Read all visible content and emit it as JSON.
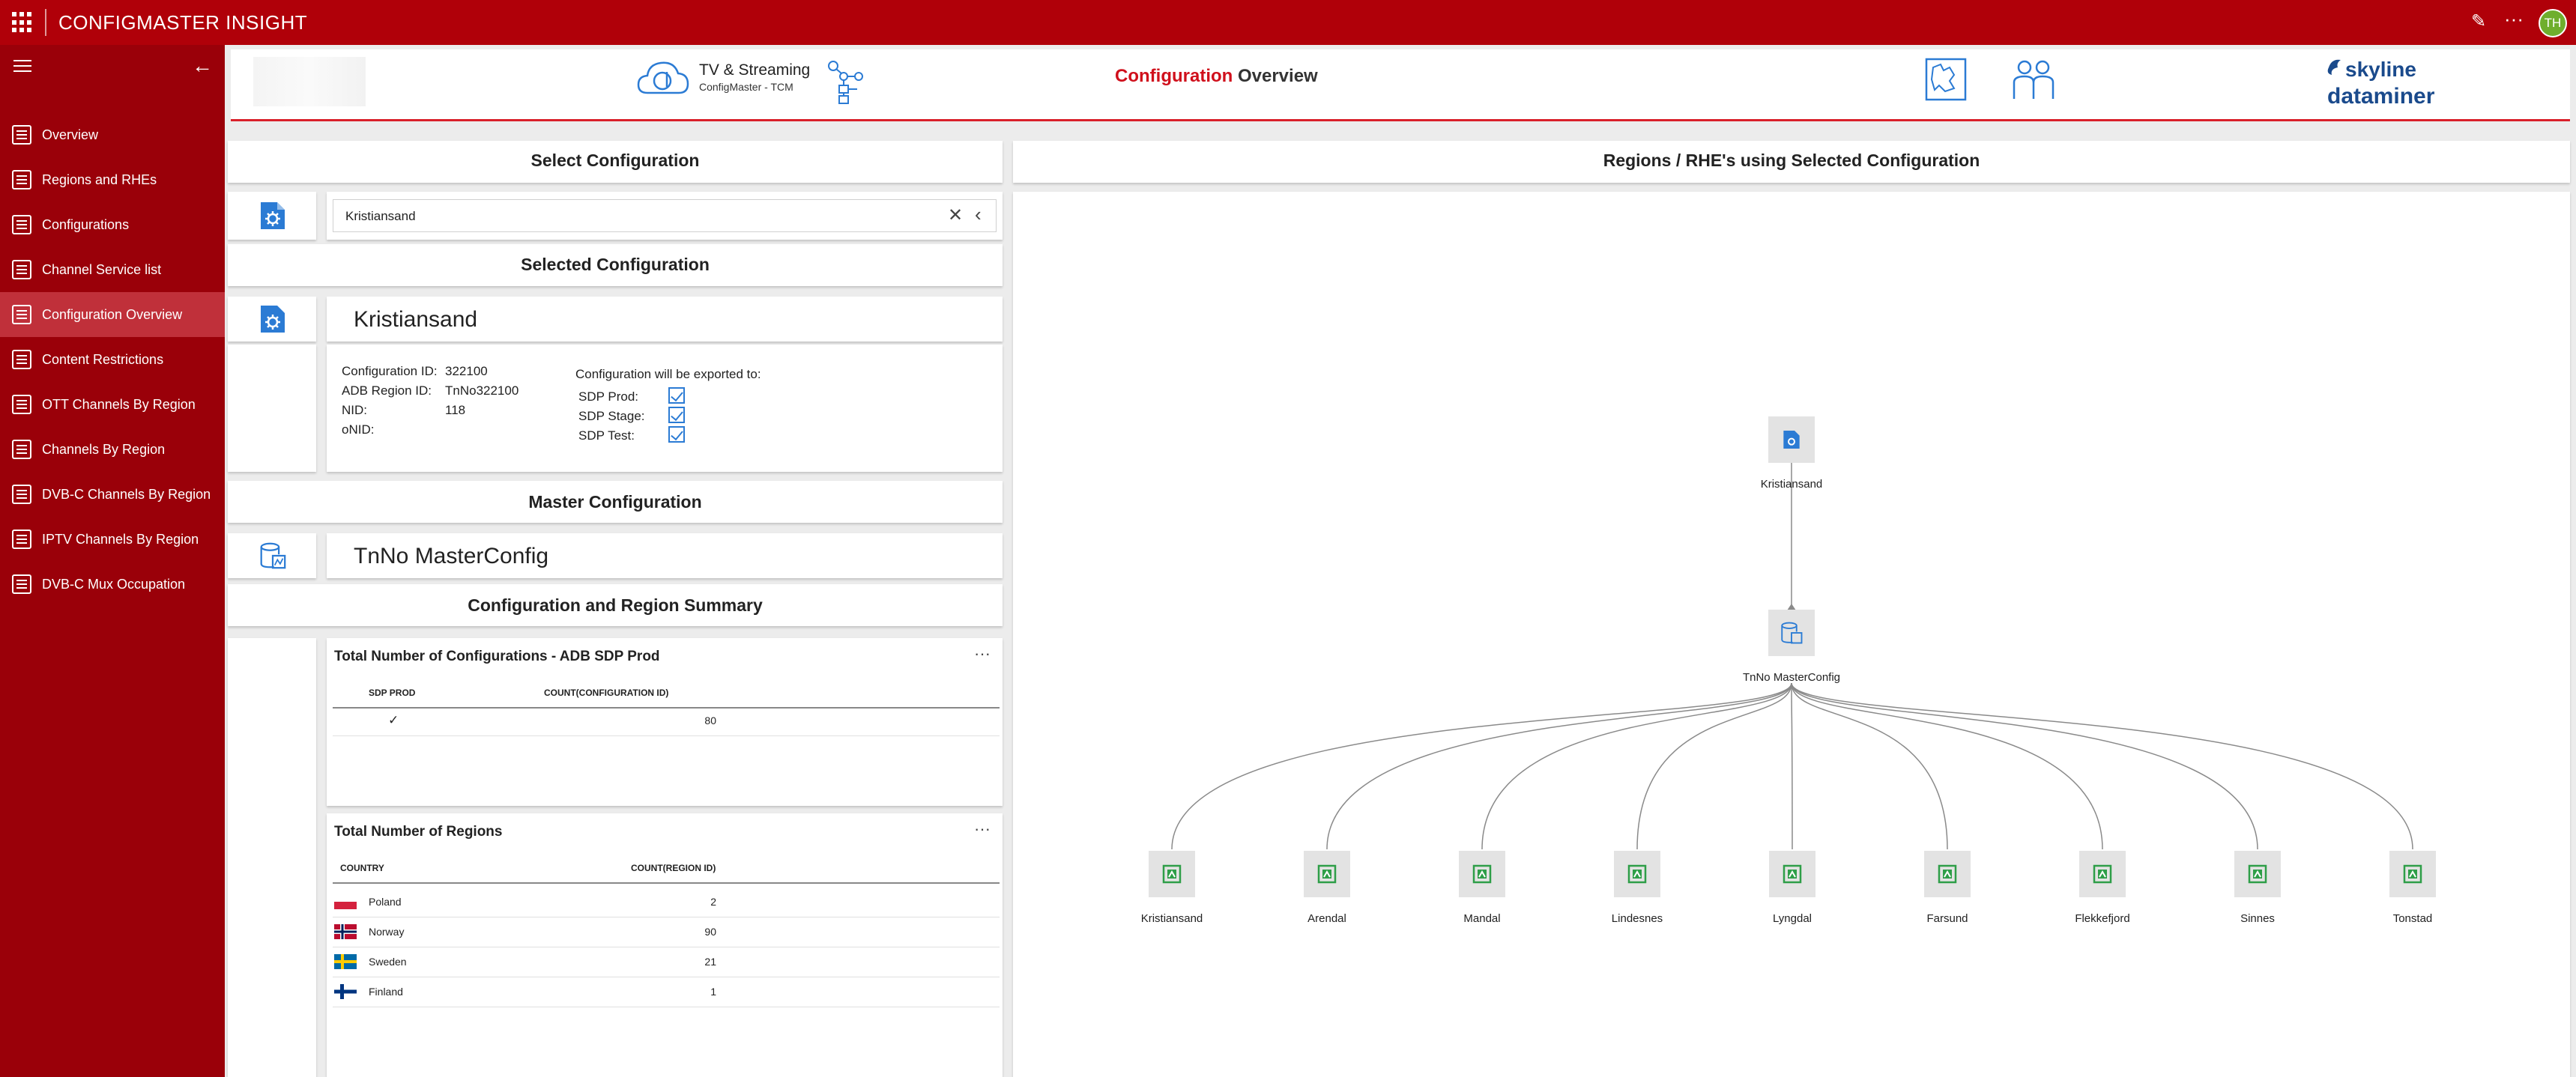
{
  "app": {
    "title": "CONFIGMASTER INSIGHT",
    "user_initials": "TH"
  },
  "sidebar": {
    "items": [
      {
        "label": "Overview",
        "icon": "table-icon"
      },
      {
        "label": "Regions and RHEs",
        "icon": "report-icon"
      },
      {
        "label": "Configurations",
        "icon": "config-file-icon"
      },
      {
        "label": "Channel Service list",
        "icon": "service-list-icon"
      },
      {
        "label": "Configuration Overview",
        "icon": "config-file-icon",
        "active": true
      },
      {
        "label": "Content Restrictions",
        "icon": "lock-icon"
      },
      {
        "label": "OTT Channels By Region",
        "icon": "list-icon"
      },
      {
        "label": "Channels By Region",
        "icon": "list-icon"
      },
      {
        "label": "DVB-C Channels By Region",
        "icon": "list-icon"
      },
      {
        "label": "IPTV Channels By Region",
        "icon": "list-icon"
      },
      {
        "label": "DVB-C Mux Occupation",
        "icon": "pie-chart-icon"
      }
    ]
  },
  "header": {
    "product_title": "TV & Streaming",
    "product_subtitle": "ConfigMaster - TCM",
    "page_title_accent": "Configuration",
    "page_title_rest": " Overview",
    "brand_top": "skyline",
    "brand_bottom": "dataminer"
  },
  "select_config": {
    "title": "Select Configuration",
    "search_value": "Kristiansand"
  },
  "selected_config": {
    "title": "Selected Configuration",
    "name": "Kristiansand",
    "fields": [
      {
        "label": "Configuration ID:",
        "value": "322100"
      },
      {
        "label": "ADB Region ID:",
        "value": "TnNo322100"
      },
      {
        "label": "NID:",
        "value": "118"
      },
      {
        "label": "oNID:",
        "value": ""
      }
    ],
    "export_title": "Configuration will be exported to:",
    "exports": [
      {
        "label": "SDP Prod:",
        "checked": true
      },
      {
        "label": "SDP Stage:",
        "checked": true
      },
      {
        "label": "SDP Test:",
        "checked": true
      }
    ]
  },
  "master_config": {
    "title": "Master Configuration",
    "name": "TnNo MasterConfig"
  },
  "summary": {
    "title": "Configuration and Region Summary",
    "configs_table": {
      "title": "Total Number of Configurations - ADB SDP Prod",
      "columns": [
        "SDP PROD",
        "COUNT(CONFIGURATION ID)"
      ],
      "rows": [
        {
          "prod": "✓",
          "count": "80"
        }
      ]
    },
    "regions_table": {
      "title": "Total Number of Regions",
      "columns": [
        "COUNTRY",
        "COUNT(REGION ID)"
      ],
      "rows": [
        {
          "country": "Poland",
          "count": "2",
          "flag": "poland"
        },
        {
          "country": "Norway",
          "count": "90",
          "flag": "norway"
        },
        {
          "country": "Sweden",
          "count": "21",
          "flag": "sweden"
        },
        {
          "country": "Finland",
          "count": "1",
          "flag": "finland"
        }
      ]
    },
    "more": "···"
  },
  "diagram": {
    "title": "Regions / RHE's using Selected Configuration",
    "root": "Kristiansand",
    "master": "TnNo MasterConfig",
    "regions": [
      "Kristiansand",
      "Arendal",
      "Mandal",
      "Lindesnes",
      "Lyngdal",
      "Farsund",
      "Flekkefjord",
      "Sinnes",
      "Tonstad"
    ]
  },
  "colors": {
    "brand_red": "#b00009",
    "sidebar": "#9a0009",
    "accent_blue": "#2b7bd4",
    "region_green": "#2e9e48"
  }
}
